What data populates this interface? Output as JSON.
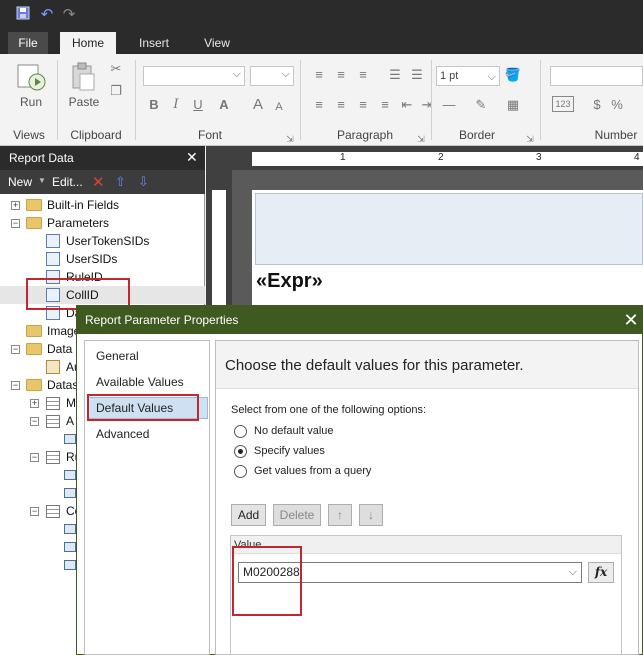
{
  "ribbon": {
    "tabs": [
      "File",
      "Home",
      "Insert",
      "View"
    ],
    "groups": {
      "views": {
        "button": "Run",
        "label": "Views"
      },
      "clipboard": {
        "button": "Paste",
        "label": "Clipboard"
      },
      "font": {
        "label": "Font",
        "buttons": [
          "B",
          "I",
          "U",
          "A",
          "A",
          "A"
        ]
      },
      "paragraph": {
        "label": "Paragraph"
      },
      "border": {
        "label": "Border",
        "width": "1 pt"
      },
      "number": {
        "label": "Number",
        "format_icon": "123",
        "currency": "$",
        "percent": "%"
      }
    }
  },
  "report_data": {
    "title": "Report Data",
    "toolbar": {
      "new": "New",
      "edit": "Edit..."
    },
    "tree": [
      {
        "label": "Built-in Fields"
      },
      {
        "label": "Parameters"
      },
      {
        "label": "UserTokenSIDs"
      },
      {
        "label": "UserSIDs"
      },
      {
        "label": "RuleID"
      },
      {
        "label": "CollID"
      },
      {
        "label": "Da"
      },
      {
        "label": "Image"
      },
      {
        "label": "Data S"
      },
      {
        "label": "Au"
      },
      {
        "label": "Datas"
      },
      {
        "label": "M"
      },
      {
        "label": "A"
      },
      {
        "label": "Ru"
      },
      {
        "label": "Co"
      }
    ]
  },
  "design": {
    "ruler_marks": [
      "1",
      "2",
      "3",
      "4"
    ],
    "expression": "«Expr»"
  },
  "dialog": {
    "title": "Report Parameter Properties",
    "nav": [
      "General",
      "Available Values",
      "Default Values",
      "Advanced"
    ],
    "heading": "Choose the default values for this parameter.",
    "instruction": "Select from one of the following options:",
    "options": [
      "No default value",
      "Specify values",
      "Get values from a query"
    ],
    "selected_option": "Specify values",
    "buttons": {
      "add": "Add",
      "delete": "Delete",
      "up": "↑",
      "down": "↓"
    },
    "grid_header": "Value",
    "value": "M0200288",
    "fx": "fx"
  },
  "colors": {
    "dialog_title": "#3f5a20",
    "annotation": "#c0282f",
    "dark_bar": "#2b2b2b"
  }
}
